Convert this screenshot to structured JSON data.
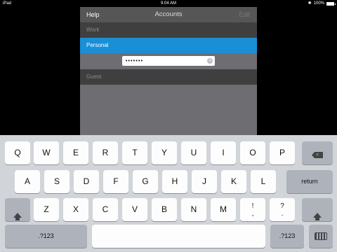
{
  "status_bar": {
    "device": "iPad",
    "time": "9:04 AM",
    "battery_label": "100%",
    "battery_level": 1.0
  },
  "panel": {
    "help_label": "Help",
    "title": "Accounts",
    "edit_label": "Edit",
    "accounts": {
      "work": "Work",
      "personal": "Personal",
      "guest": "Guest"
    },
    "password_value": "•••••••"
  },
  "keyboard": {
    "row1": [
      "Q",
      "W",
      "E",
      "R",
      "T",
      "Y",
      "U",
      "I",
      "O",
      "P"
    ],
    "row2": [
      "A",
      "S",
      "D",
      "F",
      "G",
      "H",
      "J",
      "K",
      "L"
    ],
    "row3": [
      "Z",
      "X",
      "C",
      "V",
      "B",
      "N",
      "M"
    ],
    "punct1": [
      "!",
      ","
    ],
    "punct2": [
      "?",
      "."
    ],
    "return_label": "return",
    "mode_label": ".?123",
    "icons": {
      "shift": "shift-icon",
      "backspace": "backspace-icon",
      "hide_keyboard": "keyboard-hide-icon",
      "wifi": "wifi-icon",
      "bluetooth": "bluetooth-icon",
      "battery": "battery-icon",
      "clear": "clear-icon"
    }
  },
  "colors": {
    "selected_row": "#1a8fd6",
    "panel_bg": "#6d6d72",
    "keyboard_bg": "#d1d4d9"
  }
}
